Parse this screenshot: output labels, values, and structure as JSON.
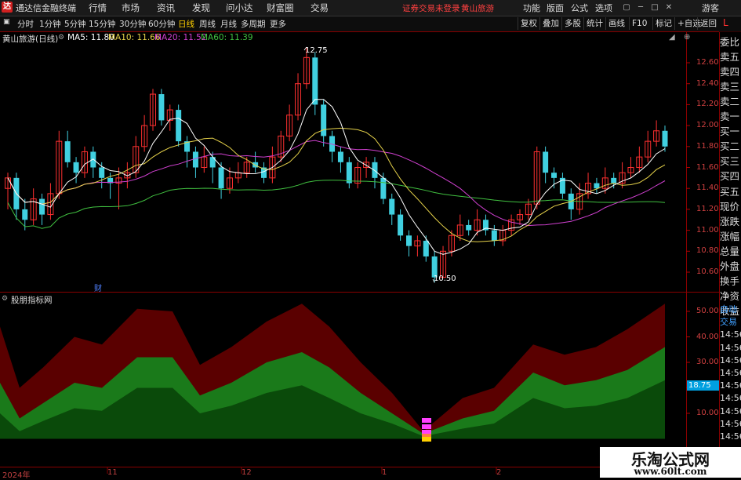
{
  "app": {
    "title": "通达信金融终端",
    "login_notice": "证券交易未登录",
    "stock_name": "黄山旅游",
    "guest": "游客"
  },
  "menu": [
    "行情",
    "市场",
    "资讯",
    "发现",
    "问小达",
    "财富圈",
    "交易"
  ],
  "menu_right": [
    "功能",
    "版面",
    "公式",
    "选项"
  ],
  "periods": [
    "分时",
    "1分钟",
    "5分钟",
    "15分钟",
    "30分钟",
    "60分钟",
    "日线",
    "周线",
    "月线",
    "多周期",
    "更多"
  ],
  "tool_right": [
    "复权",
    "叠加",
    "多股",
    "统计",
    "画线",
    "F10",
    "标记",
    "+自选",
    "返回"
  ],
  "legend": {
    "title": "黄山旅游(日线)",
    "ma5": "MA5: 11.80",
    "ma10": "MA10: 11.66",
    "ma20": "MA20: 11.52",
    "ma60": "MA60: 11.39"
  },
  "colors": {
    "ma5": "#ffffff",
    "ma10": "#e6d24a",
    "ma20": "#d040d0",
    "ma60": "#40c040",
    "up": "#ff3030",
    "down": "#40d0e0",
    "darkred": "#5a0000",
    "green": "#1a7a1a",
    "darkgreen": "#0a4a0a"
  },
  "price_axis": [
    "12.60",
    "12.40",
    "12.20",
    "12.00",
    "11.80",
    "11.60",
    "11.40",
    "11.20",
    "11.00",
    "10.80",
    "10.60"
  ],
  "high_mark": "12.75",
  "low_mark": "10.50",
  "cai": "财",
  "indicator": {
    "title": "股朋指标网"
  },
  "indicator_axis": [
    "50.00",
    "40.00",
    "30.00",
    "20.00",
    "10.00"
  ],
  "current_value": "18.75",
  "time_axis": [
    "2024年",
    "11",
    "12",
    "1",
    "2"
  ],
  "side_tabs": [
    "委比",
    "卖五",
    "卖四",
    "卖三",
    "卖二",
    "卖一",
    "买一",
    "买二",
    "买三",
    "买四",
    "买五",
    "现价",
    "涨跌",
    "涨幅",
    "总量",
    "外盘",
    "换手",
    "净资",
    "收益"
  ],
  "side_lower": [
    "自动",
    "交易",
    "14:56",
    "14:56",
    "14:56",
    "14:56",
    "14:56",
    "14:56",
    "14:56",
    "14:56",
    "14:56"
  ],
  "watermark": {
    "line1": "乐淘公式网",
    "line2": "www.60lt.com"
  },
  "chart_data": {
    "type": "candlestick",
    "ylim": [
      10.45,
      12.85
    ],
    "candles": [
      [
        11.4,
        11.5,
        11.55,
        11.2
      ],
      [
        11.5,
        11.2,
        11.55,
        11.1
      ],
      [
        11.2,
        11.1,
        11.3,
        11.0
      ],
      [
        11.1,
        11.3,
        11.4,
        11.05
      ],
      [
        11.3,
        11.15,
        11.35,
        11.05
      ],
      [
        11.15,
        11.35,
        11.45,
        11.1
      ],
      [
        11.35,
        11.85,
        11.95,
        11.3
      ],
      [
        11.85,
        11.65,
        11.95,
        11.6
      ],
      [
        11.65,
        11.55,
        11.7,
        11.45
      ],
      [
        11.55,
        11.75,
        11.8,
        11.5
      ],
      [
        11.75,
        11.6,
        11.8,
        11.5
      ],
      [
        11.6,
        11.5,
        11.65,
        11.4
      ],
      [
        11.5,
        11.45,
        11.55,
        11.3
      ],
      [
        11.45,
        11.5,
        11.6,
        11.2
      ],
      [
        11.5,
        11.55,
        11.65,
        11.4
      ],
      [
        11.55,
        11.8,
        11.9,
        11.5
      ],
      [
        11.8,
        12.0,
        12.1,
        11.75
      ],
      [
        12.0,
        12.3,
        12.35,
        11.95
      ],
      [
        12.3,
        12.05,
        12.35,
        12.0
      ],
      [
        12.05,
        12.15,
        12.2,
        11.95
      ],
      [
        12.15,
        11.85,
        12.2,
        11.8
      ],
      [
        11.85,
        11.75,
        11.9,
        11.6
      ],
      [
        11.75,
        11.6,
        11.8,
        11.5
      ],
      [
        11.6,
        11.7,
        11.8,
        11.55
      ],
      [
        11.7,
        11.6,
        11.75,
        11.45
      ],
      [
        11.6,
        11.4,
        11.65,
        11.3
      ],
      [
        11.4,
        11.5,
        11.6,
        11.35
      ],
      [
        11.5,
        11.55,
        11.65,
        11.45
      ],
      [
        11.55,
        11.65,
        11.7,
        11.5
      ],
      [
        11.65,
        11.6,
        11.75,
        11.55
      ],
      [
        11.6,
        11.5,
        11.65,
        11.45
      ],
      [
        11.5,
        11.7,
        11.8,
        11.45
      ],
      [
        11.7,
        11.9,
        11.95,
        11.65
      ],
      [
        11.9,
        12.1,
        12.2,
        11.85
      ],
      [
        12.1,
        12.4,
        12.5,
        12.05
      ],
      [
        12.4,
        12.65,
        12.75,
        12.35
      ],
      [
        12.65,
        12.2,
        12.7,
        12.1
      ],
      [
        12.2,
        11.9,
        12.25,
        11.8
      ],
      [
        11.9,
        11.75,
        11.95,
        11.65
      ],
      [
        11.75,
        11.65,
        11.8,
        11.55
      ],
      [
        11.65,
        11.45,
        11.7,
        11.4
      ],
      [
        11.45,
        11.6,
        11.65,
        11.4
      ],
      [
        11.6,
        11.65,
        11.7,
        11.5
      ],
      [
        11.65,
        11.5,
        11.7,
        11.4
      ],
      [
        11.5,
        11.3,
        11.55,
        11.25
      ],
      [
        11.3,
        11.15,
        11.35,
        11.05
      ],
      [
        11.15,
        10.95,
        11.2,
        10.9
      ],
      [
        10.95,
        10.85,
        11.0,
        10.75
      ],
      [
        10.85,
        10.9,
        10.95,
        10.75
      ],
      [
        10.9,
        10.75,
        10.95,
        10.7
      ],
      [
        10.75,
        10.55,
        10.8,
        10.5
      ],
      [
        10.55,
        10.8,
        10.85,
        10.55
      ],
      [
        10.8,
        10.95,
        11.0,
        10.75
      ],
      [
        10.95,
        11.05,
        11.15,
        10.9
      ],
      [
        11.05,
        11.0,
        11.1,
        10.95
      ],
      [
        11.0,
        11.1,
        11.2,
        10.95
      ],
      [
        11.1,
        11.0,
        11.15,
        10.95
      ],
      [
        11.0,
        10.9,
        11.05,
        10.85
      ],
      [
        10.9,
        11.0,
        11.05,
        10.85
      ],
      [
        11.0,
        11.1,
        11.15,
        10.95
      ],
      [
        11.1,
        11.15,
        11.2,
        11.05
      ],
      [
        11.15,
        11.25,
        11.3,
        11.1
      ],
      [
        11.25,
        11.75,
        11.8,
        11.2
      ],
      [
        11.75,
        11.55,
        11.8,
        11.45
      ],
      [
        11.55,
        11.5,
        11.6,
        11.4
      ],
      [
        11.5,
        11.35,
        11.55,
        11.3
      ],
      [
        11.35,
        11.2,
        11.4,
        11.1
      ],
      [
        11.2,
        11.35,
        11.45,
        11.15
      ],
      [
        11.35,
        11.45,
        11.55,
        11.3
      ],
      [
        11.45,
        11.4,
        11.5,
        11.35
      ],
      [
        11.4,
        11.5,
        11.6,
        11.35
      ],
      [
        11.5,
        11.45,
        11.55,
        11.4
      ],
      [
        11.45,
        11.55,
        11.65,
        11.4
      ],
      [
        11.55,
        11.6,
        11.7,
        11.5
      ],
      [
        11.6,
        11.7,
        11.8,
        11.55
      ],
      [
        11.7,
        11.85,
        11.95,
        11.65
      ],
      [
        11.85,
        11.95,
        12.05,
        11.8
      ],
      [
        11.95,
        11.8,
        12.0,
        11.75
      ]
    ]
  }
}
